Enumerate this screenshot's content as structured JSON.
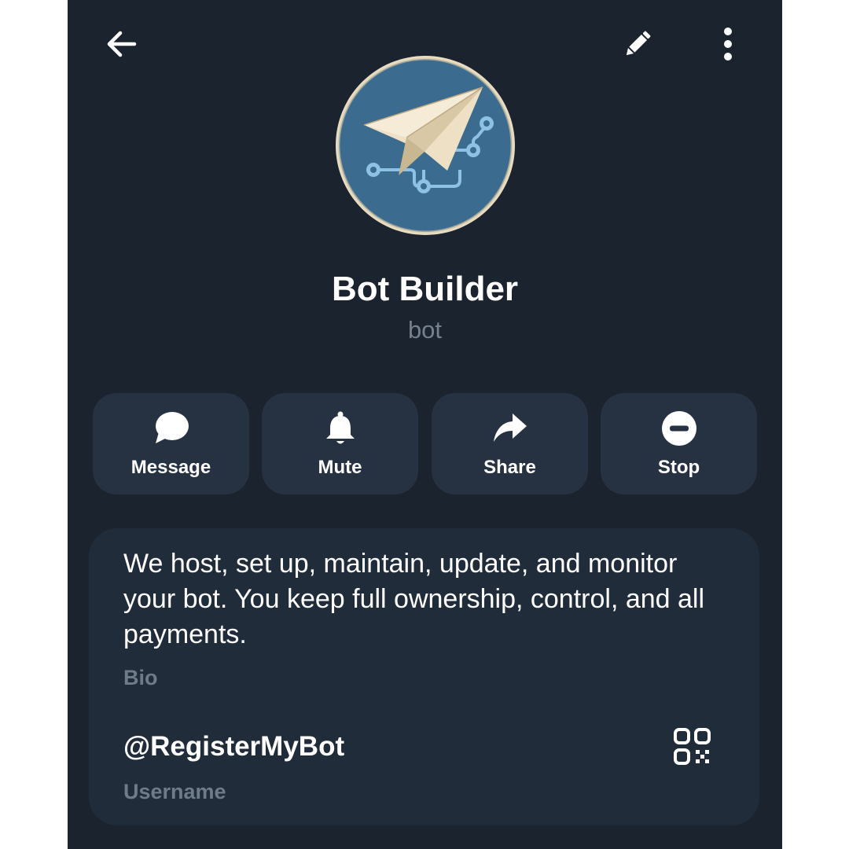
{
  "header": {
    "back_icon": "arrow-left-icon",
    "edit_icon": "pencil-icon",
    "more_icon": "more-vertical-icon"
  },
  "profile": {
    "avatar_icon": "paper-plane-network-icon",
    "name": "Bot Builder",
    "status": "bot"
  },
  "actions": [
    {
      "label": "Message",
      "icon": "chat-bubble-icon"
    },
    {
      "label": "Mute",
      "icon": "bell-icon"
    },
    {
      "label": "Share",
      "icon": "share-arrow-icon"
    },
    {
      "label": "Stop",
      "icon": "stop-circle-icon"
    }
  ],
  "info": {
    "bio": "We host, set up, maintain, update, and monitor your bot. You keep full ownership, control, and all payments.",
    "bio_label": "Bio",
    "username": "@RegisterMyBot",
    "username_label": "Username",
    "qr_icon": "qr-code-icon"
  },
  "colors": {
    "background": "#1a232e",
    "button_bg": "#263241",
    "card_bg": "#212c3a",
    "secondary_text": "#75818f"
  }
}
